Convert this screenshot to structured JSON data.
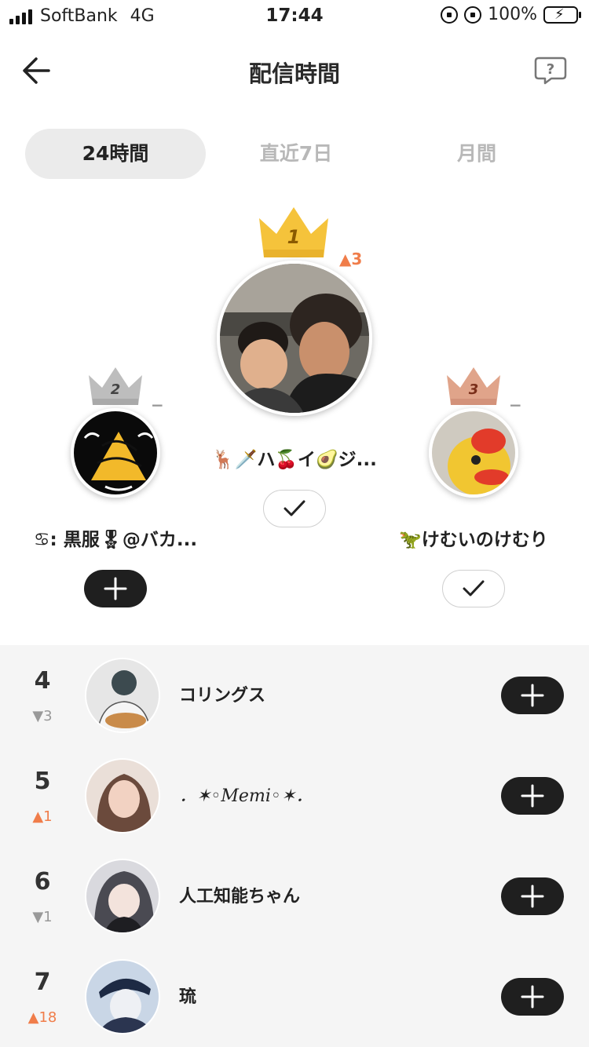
{
  "status_bar": {
    "carrier": "SoftBank",
    "network": "4G",
    "time": "17:44",
    "battery": "100%"
  },
  "header": {
    "title": "配信時間",
    "back_icon": "arrow-left-icon",
    "help_icon": "question-bubble-icon"
  },
  "tabs": [
    {
      "label": "24時間",
      "active": true
    },
    {
      "label": "直近7日",
      "active": false
    },
    {
      "label": "月間",
      "active": false
    }
  ],
  "podium": {
    "first": {
      "rank": "1",
      "delta": "▲3",
      "name": "🦌🗡️ハ🍒イ🥑ジ...",
      "followed": true
    },
    "second": {
      "rank": "2",
      "delta": "−",
      "name": "♋︎: 黒服🎖@バカ...",
      "followed": false
    },
    "third": {
      "rank": "3",
      "delta": "−",
      "name": "🦖けむいのけむり",
      "followed": true
    }
  },
  "list": [
    {
      "rank": "4",
      "delta": "▼3",
      "direction": "down",
      "name": "コリングス"
    },
    {
      "rank": "5",
      "delta": "▲1",
      "direction": "up",
      "name": "．✶◦Memi◦✶．"
    },
    {
      "rank": "6",
      "delta": "▼1",
      "direction": "down",
      "name": "人工知能ちゃん"
    },
    {
      "rank": "7",
      "delta": "▲18",
      "direction": "up",
      "name": "琉"
    }
  ],
  "colors": {
    "gold": "#f5c33b",
    "silver": "#bdbdbd",
    "bronze": "#e0a48a",
    "accent_up": "#f07d4a",
    "follow_button": "#1f1f1f",
    "list_background": "#f5f5f5"
  }
}
